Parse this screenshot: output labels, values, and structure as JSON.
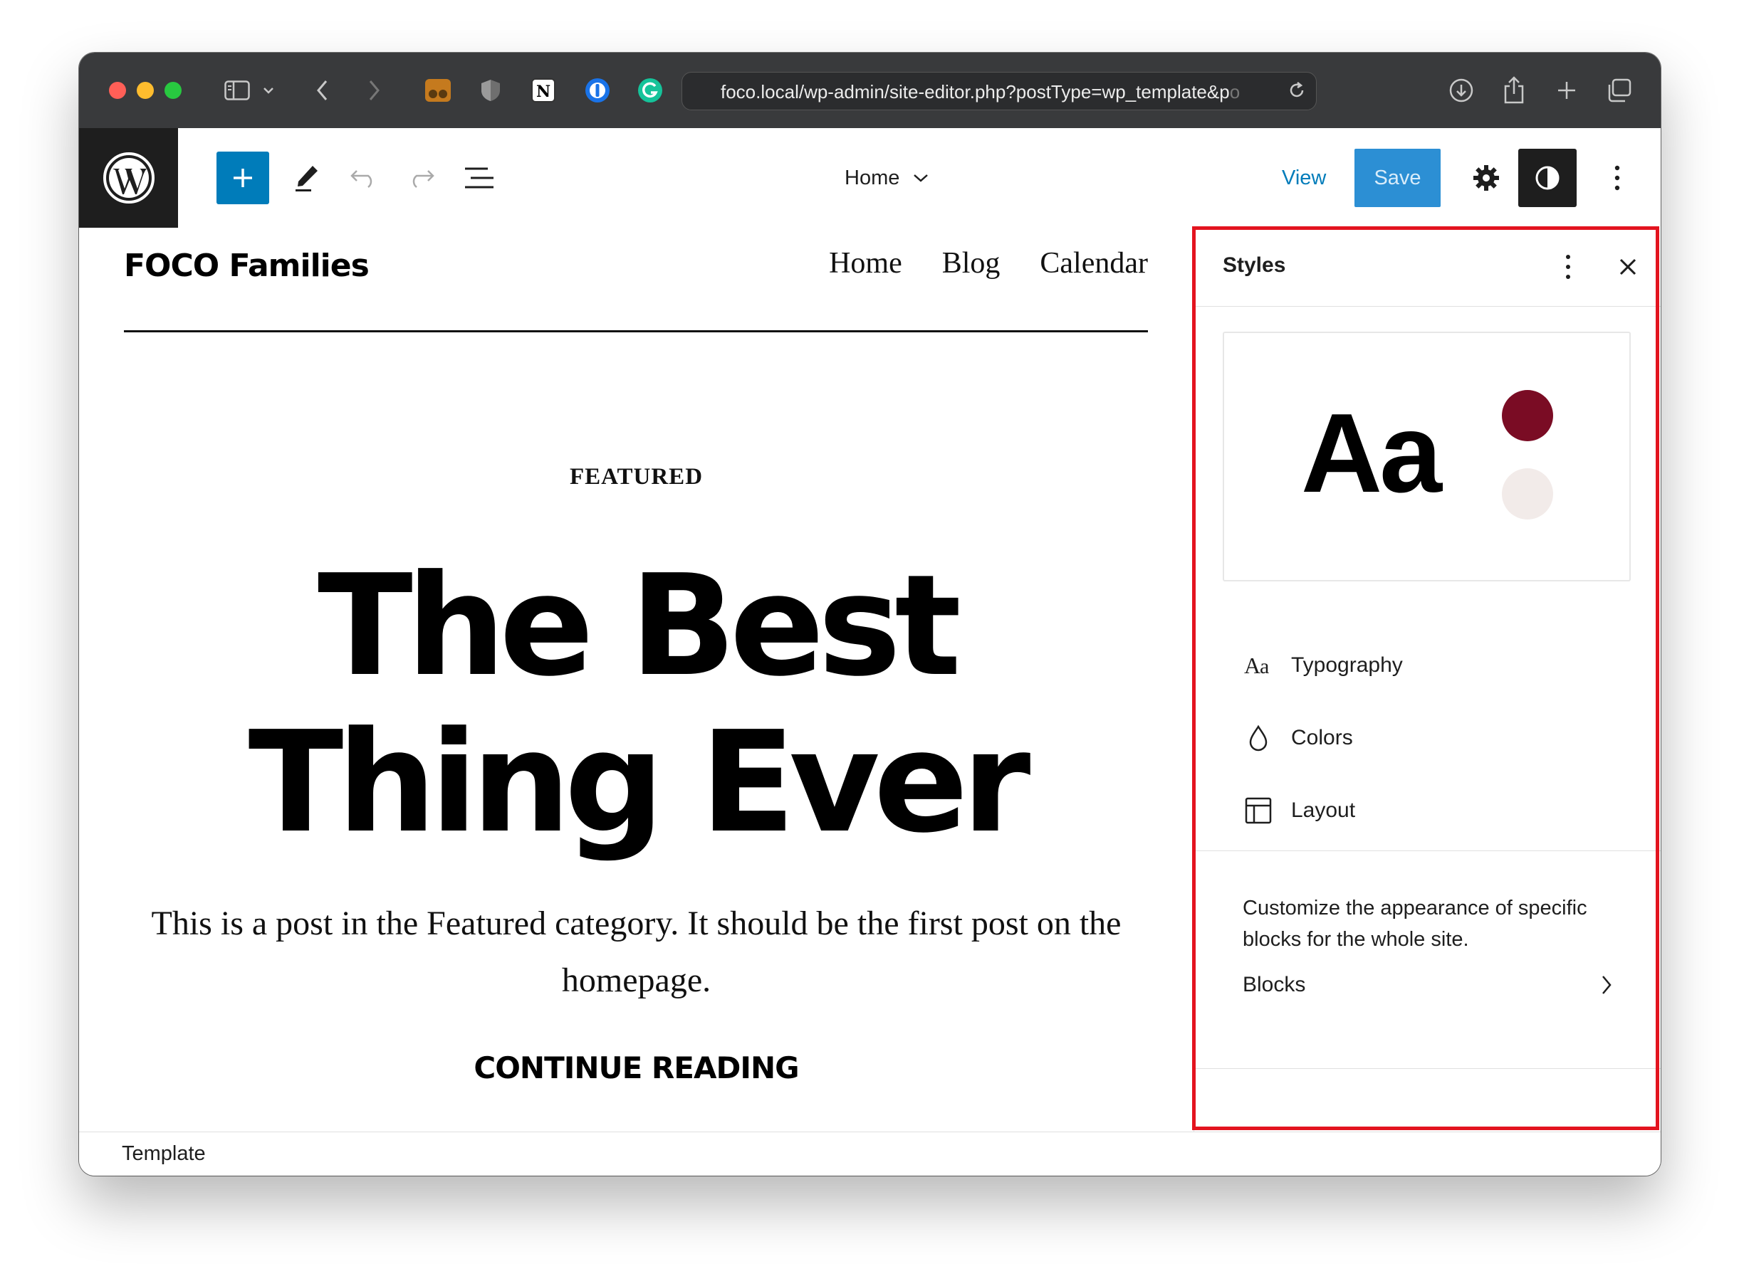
{
  "browser": {
    "url": "foco.local/wp-admin/site-editor.php?postType=wp_template&p",
    "url_fade": "o"
  },
  "toolbar": {
    "document_title": "Home",
    "view_label": "View",
    "save_label": "Save"
  },
  "site": {
    "title": "FOCO Families",
    "nav": [
      "Home",
      "Blog",
      "Calendar"
    ]
  },
  "post": {
    "category": "FEATURED",
    "title_line1": "The Best",
    "title_line2": "Thing Ever",
    "excerpt": "This is a post in the Featured category. It should be the first post on the homepage.",
    "read_more": "CONTINUE READING"
  },
  "styles_panel": {
    "title": "Styles",
    "preview_text": "Aa",
    "preview_colors": [
      "#7a0c24",
      "#f2ebe9"
    ],
    "items": [
      {
        "label": "Typography",
        "icon": "typography-icon"
      },
      {
        "label": "Colors",
        "icon": "droplet-icon"
      },
      {
        "label": "Layout",
        "icon": "layout-icon"
      }
    ],
    "blocks_description": "Customize the appearance of specific blocks for the whole site.",
    "blocks_label": "Blocks",
    "highlight_color": "#e3141f"
  },
  "footer": {
    "breadcrumb": "Template"
  },
  "colors": {
    "accent": "#007cba",
    "save_bg": "#2c8fd4"
  }
}
